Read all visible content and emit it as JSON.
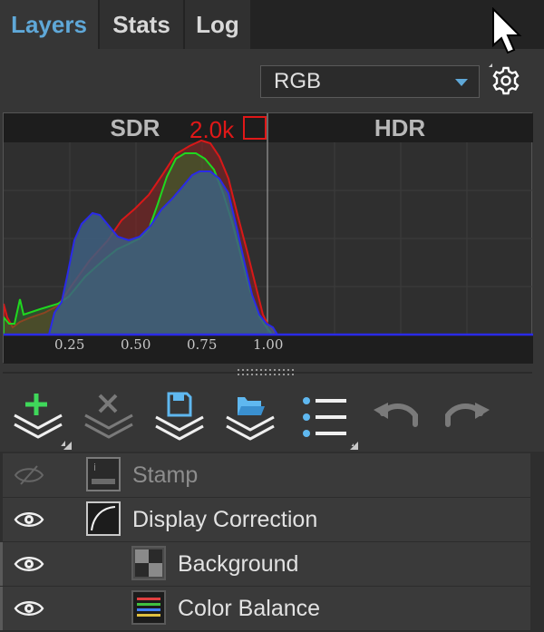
{
  "tabs": [
    {
      "label": "Layers",
      "active": true
    },
    {
      "label": "Stats",
      "active": false
    },
    {
      "label": "Log",
      "active": false
    }
  ],
  "channel_select": {
    "value": "RGB"
  },
  "histogram": {
    "sdr_label": "SDR",
    "hdr_label": "HDR",
    "count_label": "2.0k",
    "x_ticks": [
      "0.25",
      "0.50",
      "0.75",
      "1.00"
    ],
    "colors": {
      "red": "#d81818",
      "green": "#1fd81f",
      "blue": "#2a2ae8",
      "fill": "#3e5f80"
    }
  },
  "toolbar": {
    "icons": [
      "add-layer-icon",
      "delete-layer-icon",
      "save-layer-icon",
      "open-layer-icon",
      "list-menu-icon",
      "undo-icon",
      "redo-icon"
    ]
  },
  "layers": [
    {
      "name": "Stamp",
      "visible": false,
      "thumb": "stamp-thumbnail",
      "indent": 0
    },
    {
      "name": "Display Correction",
      "visible": true,
      "thumb": "curve-thumbnail",
      "indent": 0
    },
    {
      "name": "Background",
      "visible": true,
      "thumb": "checker-thumbnail",
      "indent": 1
    },
    {
      "name": "Color Balance",
      "visible": true,
      "thumb": "color-balance-thumbnail",
      "indent": 1
    }
  ],
  "accent_color": "#5fa8d8"
}
